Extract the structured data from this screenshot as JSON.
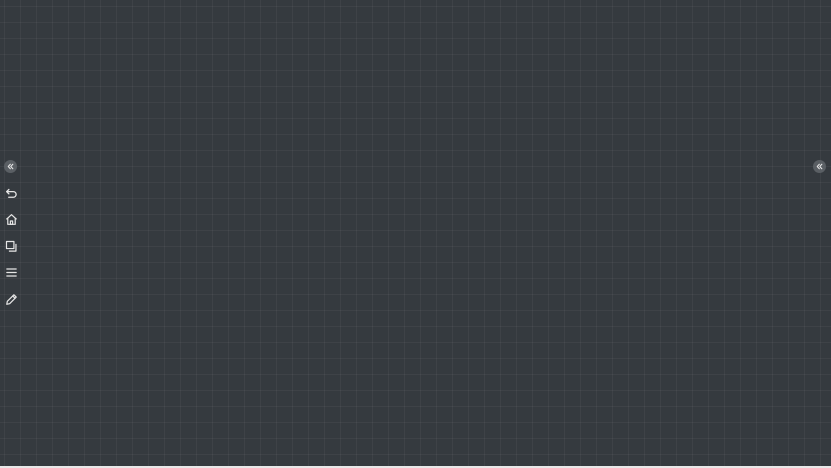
{
  "colors": {
    "canvas_bg": "#353a3f",
    "grid_line": "#3d4247",
    "icon": "#e6e6e6",
    "collapse_button_bg": "#5a5f64"
  },
  "left_panel_toggle": {
    "icon": "chevrons-left-icon"
  },
  "right_panel_toggle": {
    "icon": "chevrons-left-icon"
  },
  "toolbar": {
    "items": [
      {
        "icon": "undo-icon"
      },
      {
        "icon": "home-icon"
      },
      {
        "icon": "layers-icon"
      },
      {
        "icon": "menu-icon"
      },
      {
        "icon": "pencil-icon"
      }
    ]
  }
}
